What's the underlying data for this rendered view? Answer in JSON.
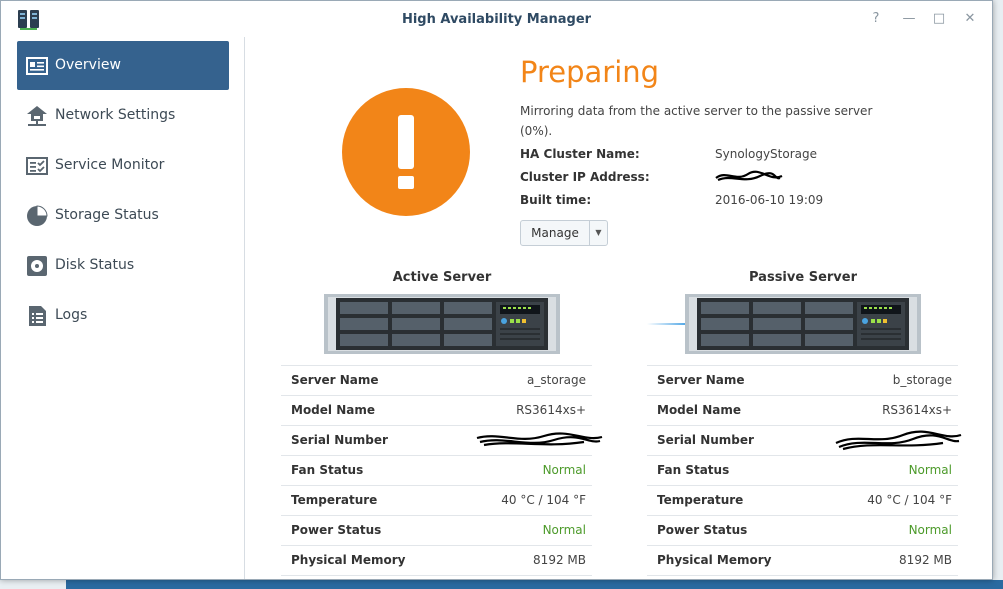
{
  "window": {
    "title": "High Availability Manager"
  },
  "titlebar_buttons": {
    "help": "?",
    "minimize": "—",
    "maximize": "□",
    "close": "✕"
  },
  "sidebar": {
    "items": [
      {
        "label": "Overview",
        "icon": "overview-icon",
        "active": true
      },
      {
        "label": "Network Settings",
        "icon": "network-icon",
        "active": false
      },
      {
        "label": "Service Monitor",
        "icon": "service-monitor-icon",
        "active": false
      },
      {
        "label": "Storage Status",
        "icon": "storage-pie-icon",
        "active": false
      },
      {
        "label": "Disk Status",
        "icon": "disk-icon",
        "active": false
      },
      {
        "label": "Logs",
        "icon": "logs-icon",
        "active": false
      }
    ]
  },
  "status": {
    "title": "Preparing",
    "description": "Mirroring data from the active server to the passive server (0%).",
    "progress_percent": 0
  },
  "cluster": {
    "name_label": "HA Cluster Name:",
    "name_value": "SynologyStorage",
    "ip_label": "Cluster IP Address:",
    "ip_value": "",
    "built_label": "Built time:",
    "built_value": "2016-06-10 19:09"
  },
  "manage": {
    "label": "Manage",
    "caret": "▼"
  },
  "active": {
    "title": "Active Server",
    "rows": [
      {
        "label": "Server Name",
        "value": "a_storage"
      },
      {
        "label": "Model Name",
        "value": "RS3614xs+"
      },
      {
        "label": "Serial Number",
        "value": ""
      },
      {
        "label": "Fan Status",
        "value": "Normal"
      },
      {
        "label": "Temperature",
        "value": "40 °C / 104 °F"
      },
      {
        "label": "Power Status",
        "value": "Normal"
      },
      {
        "label": "Physical Memory",
        "value": "8192 MB"
      }
    ]
  },
  "passive": {
    "title": "Passive Server",
    "rows": [
      {
        "label": "Server Name",
        "value": "b_storage"
      },
      {
        "label": "Model Name",
        "value": "RS3614xs+"
      },
      {
        "label": "Serial Number",
        "value": ""
      },
      {
        "label": "Fan Status",
        "value": "Normal"
      },
      {
        "label": "Temperature",
        "value": "40 °C / 104 °F"
      },
      {
        "label": "Power Status",
        "value": "Normal"
      },
      {
        "label": "Physical Memory",
        "value": "8192 MB"
      }
    ]
  },
  "colors": {
    "accent_orange": "#f28518",
    "sidebar_active": "#35628e",
    "status_ok": "#4c9a2a"
  }
}
